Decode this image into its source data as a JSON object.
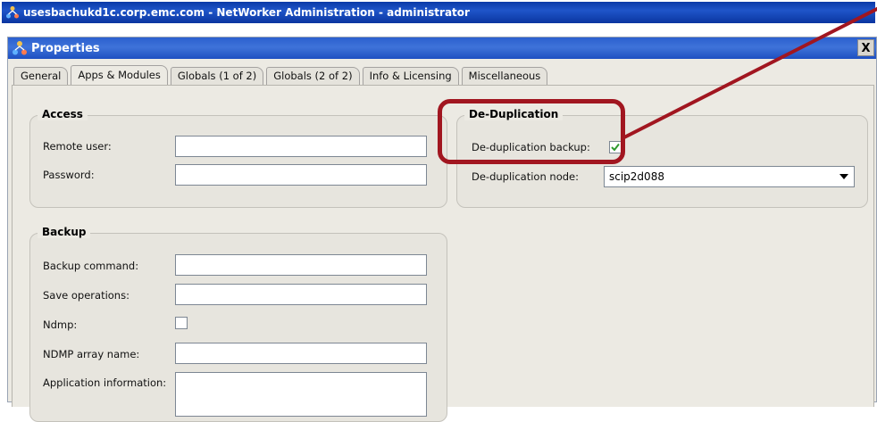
{
  "app": {
    "window_title": "usesbachukd1c.corp.emc.com - NetWorker Administration - administrator"
  },
  "dialog": {
    "title": "Properties",
    "close_glyph": "X"
  },
  "tabs": [
    {
      "label": "General",
      "active": false
    },
    {
      "label": "Apps & Modules",
      "active": true
    },
    {
      "label": "Globals (1 of 2)",
      "active": false
    },
    {
      "label": "Globals (2 of 2)",
      "active": false
    },
    {
      "label": "Info & Licensing",
      "active": false
    },
    {
      "label": "Miscellaneous",
      "active": false
    }
  ],
  "access": {
    "title": "Access",
    "remote_user_label": "Remote user:",
    "remote_user_value": "",
    "password_label": "Password:",
    "password_value": ""
  },
  "dedup": {
    "title": "De-Duplication",
    "backup_label": "De-duplication backup:",
    "backup_checked": true,
    "node_label": "De-duplication node:",
    "node_value": "scip2d088"
  },
  "backup": {
    "title": "Backup",
    "command_label": "Backup command:",
    "save_ops_label": "Save operations:",
    "ndmp_label": "Ndmp:",
    "ndmp_checked": false,
    "ndmp_array_label": "NDMP array name:",
    "app_info_label": "Application information:"
  },
  "annotation": {
    "color": "#a11620",
    "shape": "rounded-rectangle-with-arrow"
  },
  "colors": {
    "titlebar": "#0b3aa8",
    "dialog_titlebar": "#2a5fcf",
    "panel": "#eceae3",
    "check": "#2e9a2e"
  }
}
